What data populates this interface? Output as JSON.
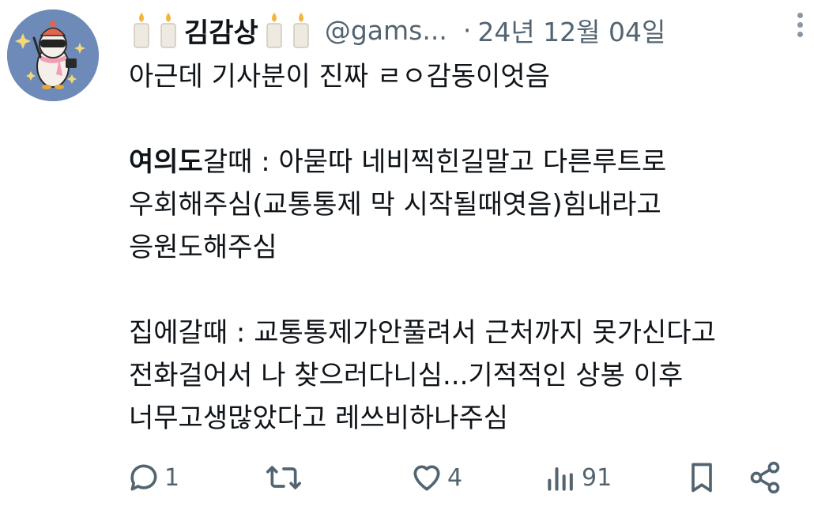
{
  "tweet": {
    "author": {
      "display_name": "김감상",
      "handle": "@gams...",
      "avatar_icon": "penguin-avatar-icon",
      "name_emoji": "candle-icon"
    },
    "separator": "·",
    "timestamp": "24년 12월 04일",
    "lines": [
      {
        "bold": "",
        "text": "아근데 기사분이 진짜 ㄹㅇ감동이엇음"
      },
      {
        "bold": "",
        "text": ""
      },
      {
        "bold": "여의도",
        "text": "갈때 : 아묻따 네비찍힌길말고 다른루트로"
      },
      {
        "bold": "",
        "text": "우회해주심(교통통제 막 시작될때엿음)힘내라고"
      },
      {
        "bold": "",
        "text": "응원도해주심"
      },
      {
        "bold": "",
        "text": ""
      },
      {
        "bold": "",
        "text": "집에갈때 : 교통통제가안풀려서 근처까지 못가신다고"
      },
      {
        "bold": "",
        "text": "전화걸어서 나 찾으러다니심...기적적인 상봉 이후"
      },
      {
        "bold": "",
        "text": "너무고생많았다고 레쓰비하나주심"
      }
    ],
    "actions": {
      "reply_count": "1",
      "retweet_count": "",
      "like_count": "4",
      "view_count": "91"
    },
    "colors": {
      "text": "#0f1419",
      "muted": "#536471",
      "avatar_bg": "#6e8ab8"
    }
  }
}
